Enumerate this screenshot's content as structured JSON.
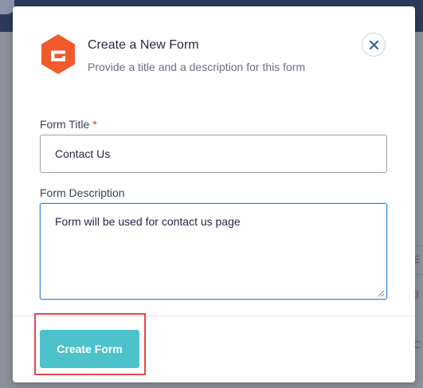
{
  "modal": {
    "title": "Create a New Form",
    "subtitle": "Provide a title and a description for this form",
    "logo_icon": "gravity-forms-logo-icon",
    "close_icon": "close-icon",
    "accent_color": "#f15a2b",
    "button_color": "#4ec2cb"
  },
  "form_title": {
    "label": "Form Title",
    "required_marker": "*",
    "value": "Contact Us"
  },
  "form_description": {
    "label": "Form Description",
    "value": "Form will be used for contact us page"
  },
  "create_button": {
    "label": "Create Form"
  }
}
